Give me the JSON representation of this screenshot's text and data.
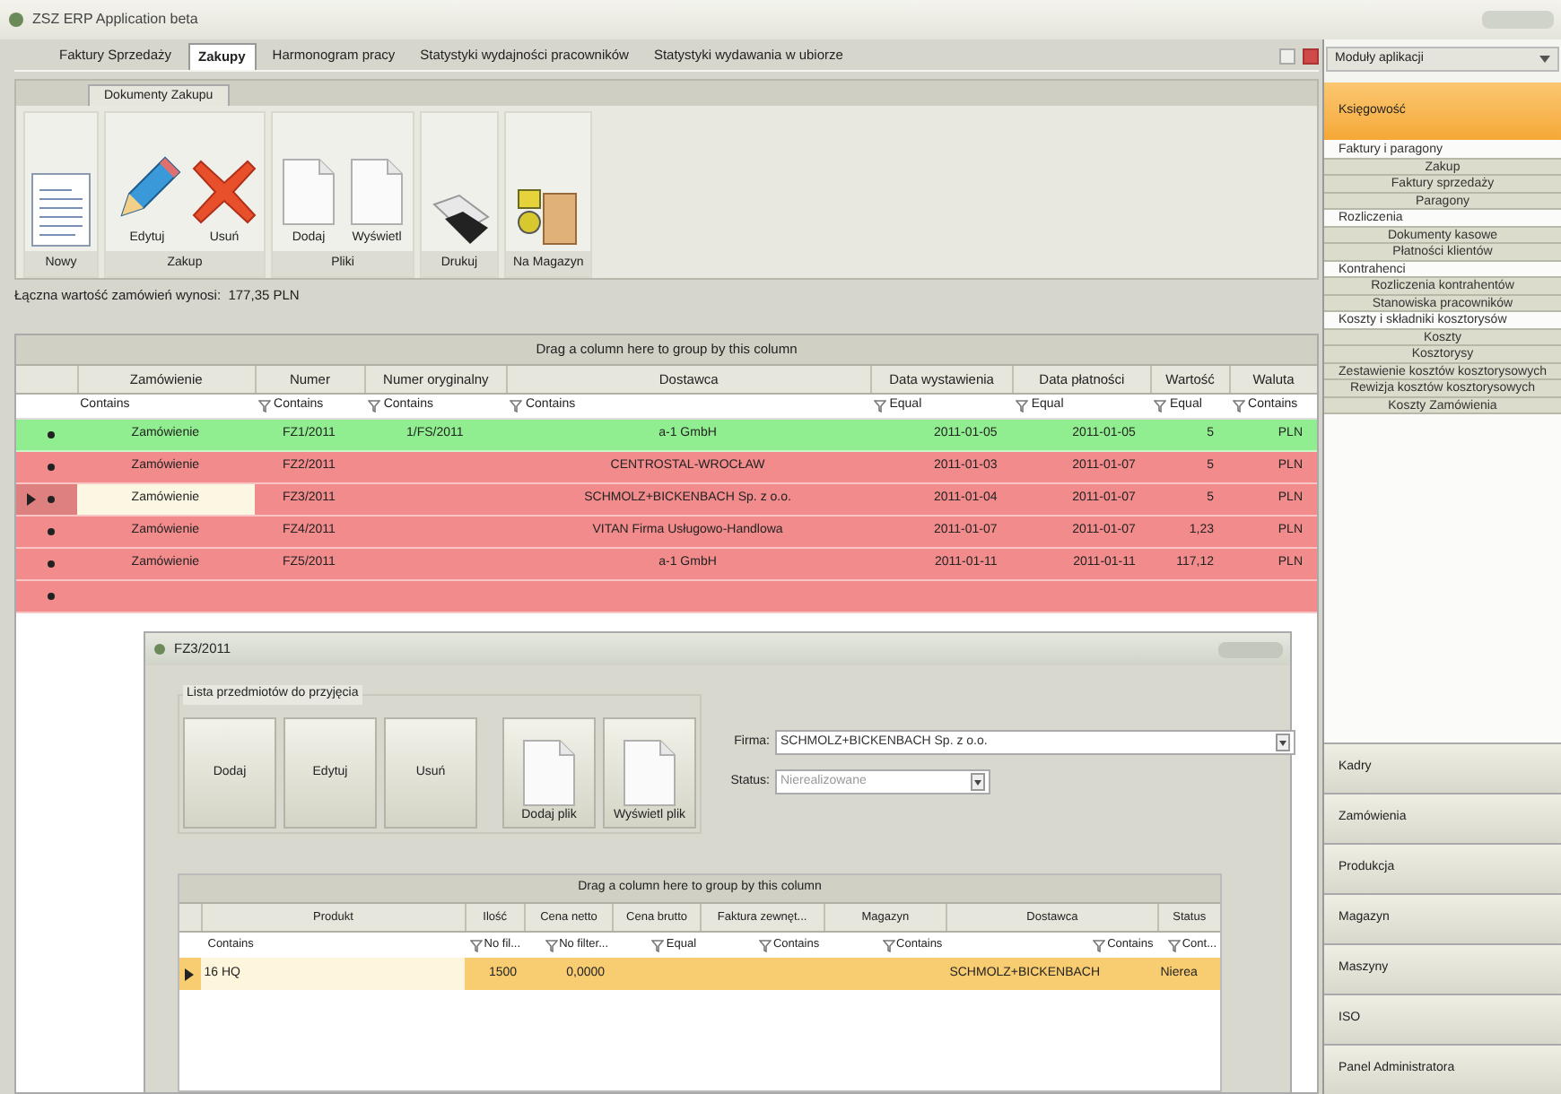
{
  "window": {
    "title": "ZSZ ERP Application beta"
  },
  "tabs": [
    {
      "label": "Faktury Sprzedaży",
      "selected": false
    },
    {
      "label": "Zakupy",
      "selected": true
    },
    {
      "label": "Harmonogram pracy",
      "selected": false
    },
    {
      "label": "Statystyki wydajności pracowników",
      "selected": false
    },
    {
      "label": "Statystyki wydawania w ubiorze",
      "selected": false
    }
  ],
  "ribbon": {
    "tab": "Dokumenty Zakupu",
    "groups": [
      {
        "buttons": [
          {
            "label": "Nowy"
          }
        ]
      },
      {
        "caption": "Zakup",
        "buttons": [
          {
            "label": "Edytuj"
          },
          {
            "label": "Usuń"
          }
        ]
      },
      {
        "caption": "Pliki",
        "buttons": [
          {
            "label": "Dodaj"
          },
          {
            "label": "Wyświetl"
          }
        ]
      },
      {
        "buttons": [
          {
            "label": "Drukuj"
          }
        ]
      },
      {
        "buttons": [
          {
            "label": "Na Magazyn"
          }
        ]
      }
    ]
  },
  "summary": "Łączna wartość zamówień wynosi:  177,35 PLN",
  "grid": {
    "group_hint": "Drag a column here to group by this column",
    "columns": [
      {
        "label": "Zamówienie",
        "filter": "Contains"
      },
      {
        "label": "Numer",
        "filter": "Contains"
      },
      {
        "label": "Numer oryginalny",
        "filter": "Contains"
      },
      {
        "label": "Dostawca",
        "filter": "Contains"
      },
      {
        "label": "Data wystawienia",
        "filter": "Equal"
      },
      {
        "label": "Data płatności",
        "filter": "Equal"
      },
      {
        "label": "Wartość",
        "filter": "Equal"
      },
      {
        "label": "Waluta",
        "filter": "Contains"
      }
    ],
    "rows": [
      {
        "color": "#90ee90",
        "selected": false,
        "cells": [
          "Zamówienie",
          "FZ1/2011",
          "1/FS/2011",
          "a-1 GmbH",
          "2011-01-05",
          "2011-01-05",
          "5",
          "PLN"
        ]
      },
      {
        "color": "#f28b8b",
        "selected": false,
        "cells": [
          "Zamówienie",
          "FZ2/2011",
          "",
          "CENTROSTAL-WROCŁAW",
          "2011-01-03",
          "2011-01-07",
          "5",
          "PLN"
        ]
      },
      {
        "color": "#f28b8b",
        "selected": true,
        "cells": [
          "Zamówienie",
          "FZ3/2011",
          "",
          "SCHMOLZ+BICKENBACH Sp. z o.o.",
          "2011-01-04",
          "2011-01-07",
          "5",
          "PLN"
        ]
      },
      {
        "color": "#f28b8b",
        "selected": false,
        "cells": [
          "Zamówienie",
          "FZ4/2011",
          "",
          "VITAN Firma Usługowo-Handlowa",
          "2011-01-07",
          "2011-01-07",
          "1,23",
          "PLN"
        ]
      },
      {
        "color": "#f28b8b",
        "selected": false,
        "cells": [
          "Zamówienie",
          "FZ5/2011",
          "",
          "a-1 GmbH",
          "2011-01-11",
          "2011-01-11",
          "117,12",
          "PLN"
        ]
      },
      {
        "color": "#f28b8b",
        "selected": false,
        "cells": []
      }
    ]
  },
  "dialog": {
    "title": "FZ3/2011",
    "group_label": "Lista przedmiotów do przyjęcia",
    "buttons": [
      {
        "label": "Dodaj"
      },
      {
        "label": "Edytuj"
      },
      {
        "label": "Usuń"
      },
      {
        "label": "Dodaj plik"
      },
      {
        "label": "Wyświetl plik"
      }
    ],
    "fields": [
      {
        "label": "Firma:",
        "value": "SCHMOLZ+BICKENBACH Sp. z o.o.",
        "disabled": false
      },
      {
        "label": "Status:",
        "value": "Nierealizowane",
        "disabled": true
      }
    ],
    "grid": {
      "group_hint": "Drag a column here to group by this column",
      "columns": [
        {
          "label": "Produkt",
          "filter": "Contains"
        },
        {
          "label": "Ilość",
          "filter": "No fil..."
        },
        {
          "label": "Cena netto",
          "filter": "No filter..."
        },
        {
          "label": "Cena brutto",
          "filter": "Equal"
        },
        {
          "label": "Faktura zewnęt...",
          "filter": "Contains"
        },
        {
          "label": "Magazyn",
          "filter": "Contains"
        },
        {
          "label": "Dostawca",
          "filter": "Contains"
        },
        {
          "label": "Status",
          "filter": "Cont..."
        }
      ],
      "rows": [
        {
          "selected": true,
          "cells": [
            "16 HQ",
            "1500",
            "0,0000",
            "",
            "",
            "",
            "SCHMOLZ+BICKENBACH",
            "Nierea"
          ]
        }
      ]
    }
  },
  "modules": {
    "dropdown": "Moduły aplikacji",
    "sections": [
      {
        "label": "Księgowość",
        "expanded": true,
        "items": [
          {
            "label": "Faktury i paragony",
            "children": [
              {
                "label": "Zakup"
              },
              {
                "label": "Faktury sprzedaży"
              },
              {
                "label": "Paragony"
              }
            ]
          },
          {
            "label": "Rozliczenia",
            "children": [
              {
                "label": "Dokumenty kasowe"
              },
              {
                "label": "Płatności klientów"
              }
            ]
          },
          {
            "label": "Kontrahenci",
            "children": [
              {
                "label": "Rozliczenia kontrahentów"
              },
              {
                "label": "Stanowiska pracowników"
              }
            ]
          },
          {
            "label": "Koszty i składniki kosztorysów",
            "children": [
              {
                "label": "Koszty"
              },
              {
                "label": "Kosztorysy"
              },
              {
                "label": "Zestawienie kosztów kosztorysowych"
              },
              {
                "label": "Rewizja kosztów kosztorysowych"
              },
              {
                "label": "Koszty Zamówienia"
              }
            ]
          }
        ]
      },
      {
        "label": "Kadry",
        "expanded": false
      },
      {
        "label": "Zamówienia",
        "expanded": false
      },
      {
        "label": "Produkcja",
        "expanded": false
      },
      {
        "label": "Magazyn",
        "expanded": false
      },
      {
        "label": "Maszyny",
        "expanded": false
      },
      {
        "label": "ISO",
        "expanded": false
      },
      {
        "label": "Panel Administratora",
        "expanded": false
      }
    ]
  }
}
